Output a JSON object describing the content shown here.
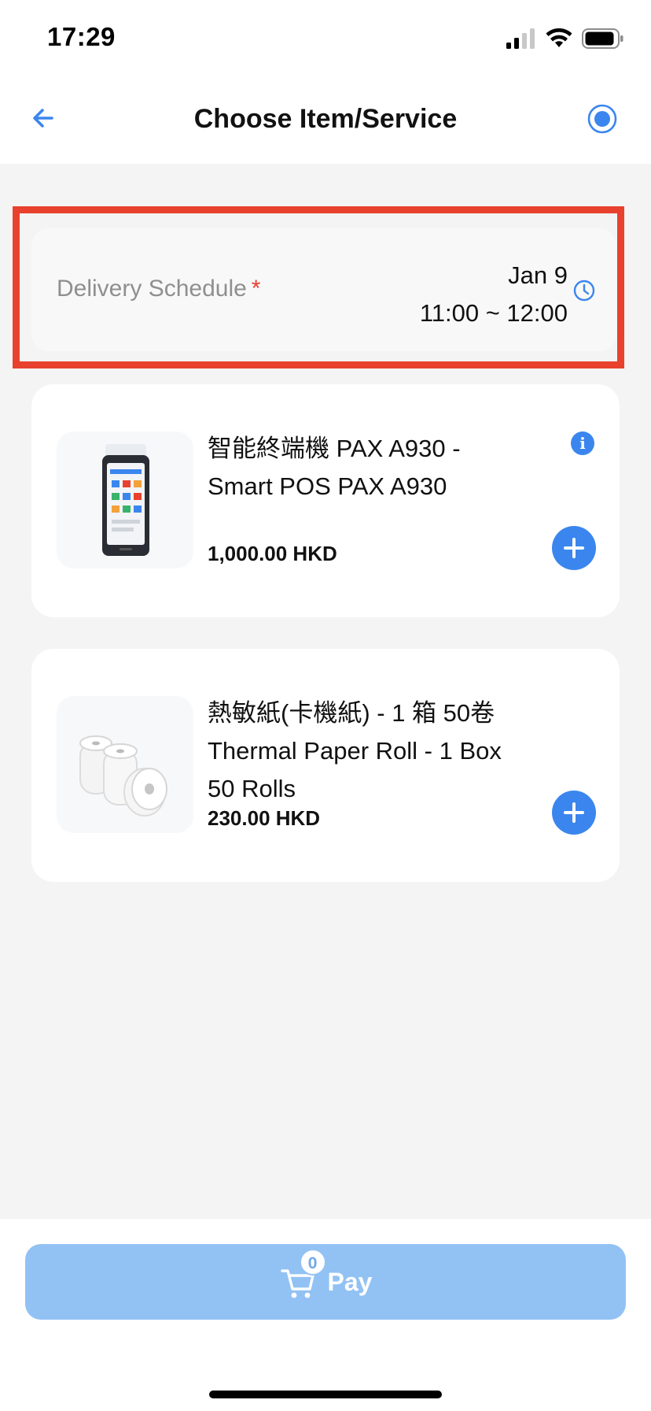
{
  "status_bar": {
    "time": "17:29"
  },
  "nav": {
    "title": "Choose Item/Service",
    "back_icon": "arrow-left-icon",
    "action_icon": "radio-target-icon"
  },
  "schedule": {
    "label": "Delivery Schedule",
    "required_mark": "*",
    "date": "Jan 9",
    "time_range": "11:00 ~ 12:00"
  },
  "products": [
    {
      "name_line1": "智能終端機 PAX A930 -",
      "name_line2": "Smart POS PAX A930",
      "price": "1,000.00 HKD",
      "info_glyph": "i"
    },
    {
      "name_line1": "熱敏紙(卡機紙) - 1 箱 50卷",
      "name_line2": "Thermal Paper Roll - 1 Box",
      "name_line3": "50 Rolls",
      "price": "230.00 HKD"
    }
  ],
  "cart": {
    "count": "0",
    "pay_label": "Pay"
  },
  "colors": {
    "accent": "#3b86ee",
    "highlight": "#e8412d",
    "pay_disabled": "#92c2f4"
  }
}
